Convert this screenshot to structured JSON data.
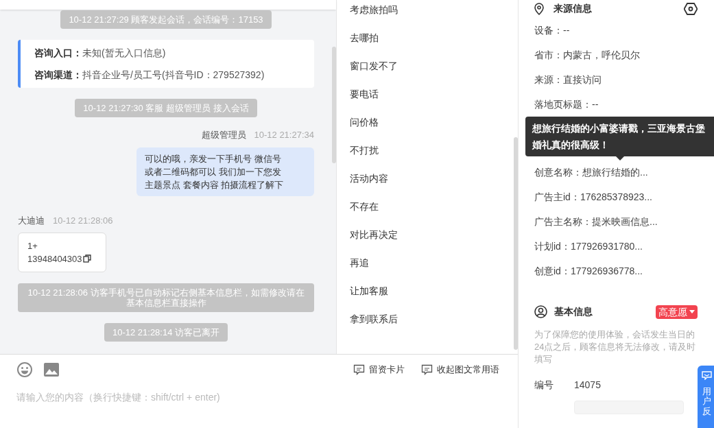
{
  "messages": [
    {
      "kind": "system",
      "text": "10-12 21:27:29 顾客发起会话，会话编号：17153"
    },
    {
      "kind": "info",
      "rows": [
        {
          "label": "咨询入口：",
          "value": "未知(暂无入口信息)"
        },
        {
          "label": "咨询渠道：",
          "value": "抖音企业号/员工号(抖音号ID：279527392)"
        }
      ]
    },
    {
      "kind": "system",
      "text": "10-12 21:27:30 客服 超级管理员 接入会话"
    },
    {
      "kind": "agent",
      "sender": "超级管理员",
      "time": "10-12 21:27:34",
      "lines": [
        "可以的哦，亲发一下手机号 微信号",
        "或者二维码都可以 我们加一下您发",
        "主题景点 套餐内容 拍摄流程了解下"
      ]
    },
    {
      "kind": "visitor",
      "sender": "大迪迪",
      "time": "10-12 21:28:06",
      "lines": [
        "1+",
        "13948404303"
      ]
    },
    {
      "kind": "system",
      "text": "10-12 21:28:06 访客手机号已自动标记右侧基本信息栏，如需修改请在基本信息栏直接操作"
    },
    {
      "kind": "system",
      "text": "10-12 21:28:14 访客已离开"
    }
  ],
  "quick_replies": [
    "考虑旅拍吗",
    "去哪拍",
    "窗口发不了",
    "要电话",
    "问价格",
    "不打扰",
    "活动内容",
    "不存在",
    "对比再决定",
    "再追",
    "让加客服",
    "拿到联系后"
  ],
  "composer": {
    "tools": [
      "留资卡片",
      "收起图文常用语"
    ],
    "placeholder": "请输入您的内容（换行快捷键：shift/ctrl + enter)"
  },
  "source_info": {
    "title": "来源信息",
    "fields": [
      "设备：--",
      "省市：内蒙古，呼伦贝尔",
      "来源：直接访问",
      "落地页标题：--"
    ],
    "fields_below_tooltip": [
      "创意名称：想旅行结婚的...",
      "广告主id：176285378923...",
      "广告主名称：提米映画信息...",
      "计划id：177926931780...",
      "创意id：177926936778..."
    ]
  },
  "tooltip": "想旅行结婚的小富婆请戳，三亚海景古堡婚礼真的很高级！",
  "basic_info": {
    "title": "基本信息",
    "intent": "高意愿",
    "notice": "为了保障您的使用体验，会话发生当日的24点之后，顾客信息将无法修改，请及时填写",
    "fields": [
      {
        "label": "编号",
        "value": "14075"
      }
    ]
  },
  "feedback": "用户反"
}
